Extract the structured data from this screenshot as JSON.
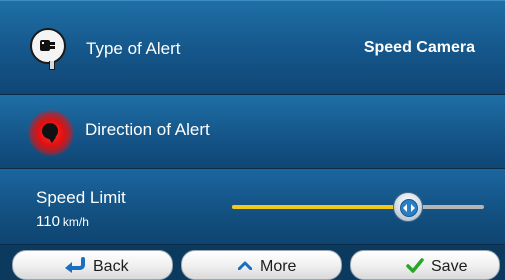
{
  "type_row": {
    "label": "Type of Alert",
    "value": "Speed Camera",
    "icon": "speed-camera-icon"
  },
  "direction_row": {
    "label": "Direction of Alert",
    "icon": "direction-marker-icon"
  },
  "speed_row": {
    "label": "Speed Limit",
    "value": "110",
    "unit": "km/h",
    "slider_fraction": 0.7,
    "fill_color": "#f2c81a",
    "track_color": "#b5b5b5"
  },
  "buttons": {
    "back": {
      "label": "Back",
      "icon": "back-arrow-icon"
    },
    "more": {
      "label": "More",
      "icon": "chevron-up-icon"
    },
    "save": {
      "label": "Save",
      "icon": "checkmark-icon"
    }
  }
}
